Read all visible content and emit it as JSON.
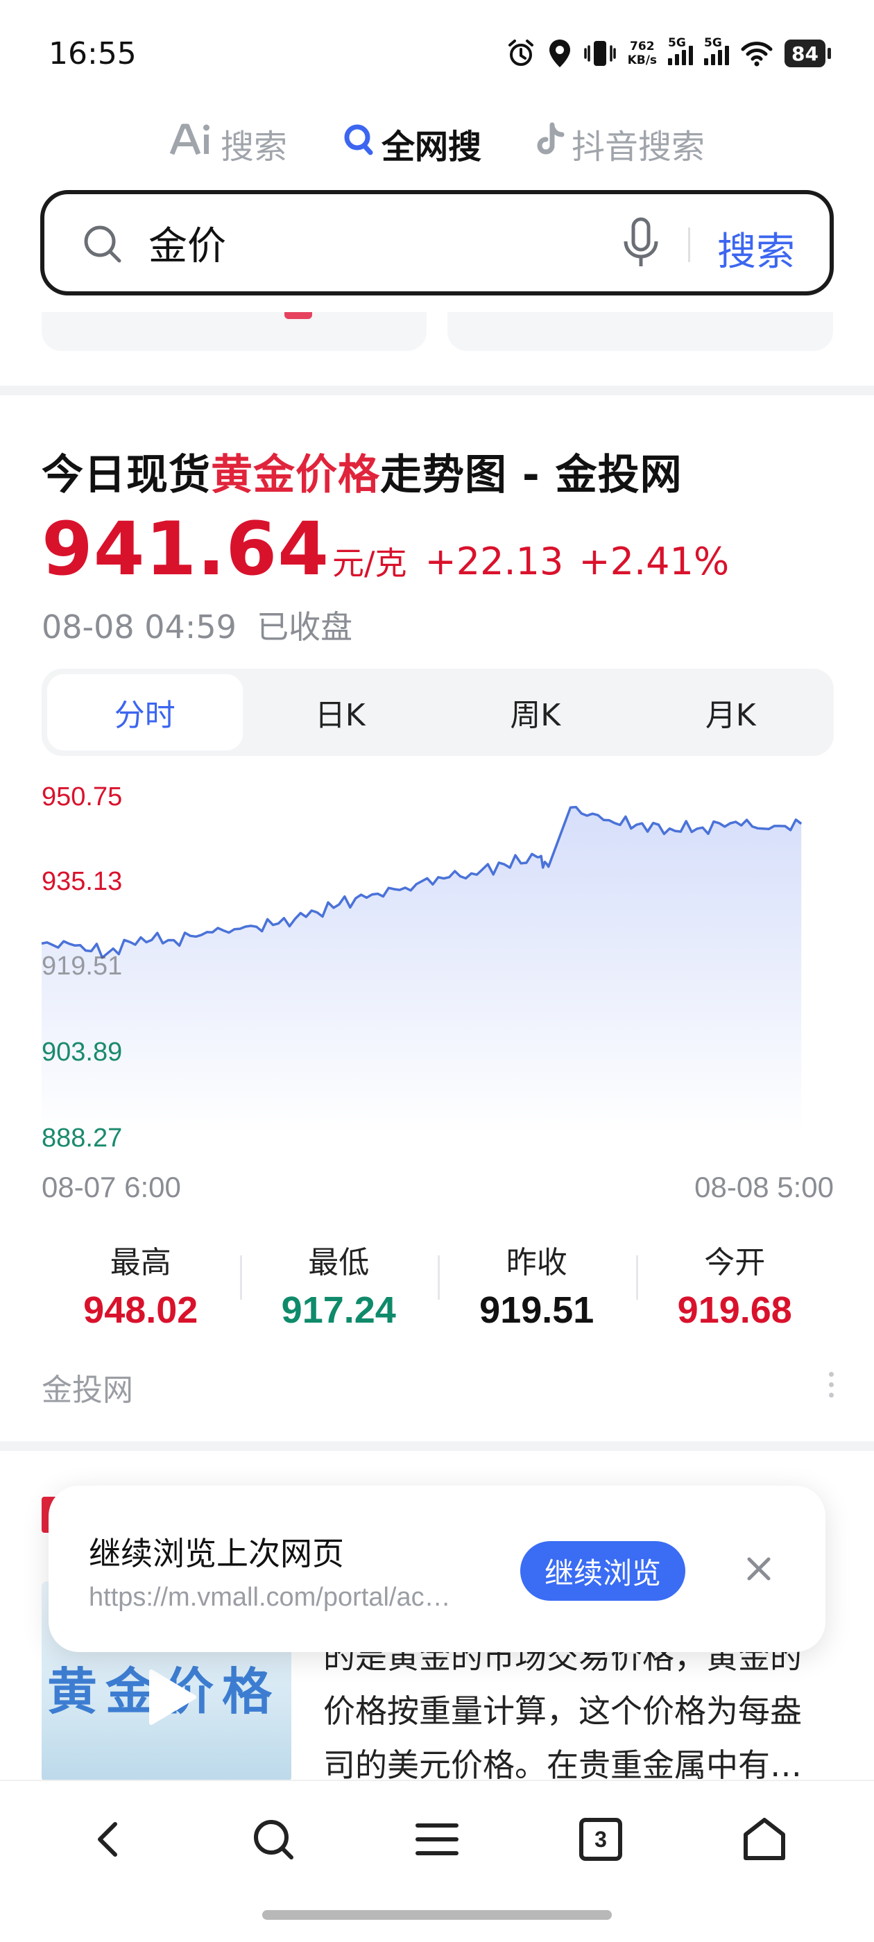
{
  "status_bar": {
    "time": "16:55",
    "net_speed_value": "762",
    "net_speed_unit": "KB/s",
    "sim1_tag": "5G",
    "sim2_tag": "5G",
    "battery": "84"
  },
  "search_tabs": [
    {
      "label": "搜索",
      "icon": "ai-icon",
      "active": false
    },
    {
      "label": "全网搜",
      "icon": "search-icon",
      "active": true
    },
    {
      "label": "抖音搜索",
      "icon": "douyin-icon",
      "active": false
    }
  ],
  "search": {
    "query": "金价",
    "button_label": "搜索"
  },
  "result": {
    "title_before": "今日现货",
    "title_highlight": "黄金价格",
    "title_after": "走势图 - 金投网",
    "price": "941.64",
    "unit": "元/克",
    "change": "+22.13",
    "change_pct": "+2.41%",
    "timestamp": "08-08 04:59",
    "market_status": "已收盘",
    "period_tabs": [
      "分时",
      "日K",
      "周K",
      "月K"
    ],
    "active_period": "分时",
    "stats": [
      {
        "label": "最高",
        "value": "948.02",
        "color": "#d9122c"
      },
      {
        "label": "最低",
        "value": "917.24",
        "color": "#0f8a6a"
      },
      {
        "label": "昨收",
        "value": "919.51",
        "color": "#111111"
      },
      {
        "label": "今开",
        "value": "919.68",
        "color": "#d9122c"
      }
    ],
    "source": "金投网"
  },
  "chart_data": {
    "type": "area",
    "title": "",
    "xlabel": "",
    "ylabel": "",
    "x_ticks": [
      "08-07 6:00",
      "08-08 5:00"
    ],
    "y_ticks": [
      "950.75",
      "935.13",
      "919.51",
      "903.89",
      "888.27"
    ],
    "ylim": [
      888.27,
      950.75
    ],
    "grid": false,
    "series": [
      {
        "x": [
          "08-07 06:00",
          "08-07 07:00",
          "08-07 08:00",
          "08-07 09:00",
          "08-07 10:00",
          "08-07 11:00",
          "08-07 12:00",
          "08-07 13:00",
          "08-07 14:00",
          "08-07 15:00",
          "08-07 16:00",
          "08-07 17:00",
          "08-07 18:00",
          "08-07 19:00",
          "08-07 20:00",
          "08-07 21:00",
          "08-07 21:20",
          "08-07 22:00",
          "08-07 23:00",
          "08-08 00:00",
          "08-08 01:00",
          "08-08 02:00",
          "08-08 03:00",
          "08-08 04:00",
          "08-08 04:59"
        ],
        "values": [
          919.3,
          918.9,
          917.3,
          920.6,
          920.0,
          921.7,
          922.4,
          923.2,
          924.9,
          927.5,
          929.6,
          931.0,
          933.2,
          934.0,
          935.9,
          937.4,
          935.4,
          947.8,
          945.2,
          944.2,
          943.4,
          943.6,
          944.8,
          943.3,
          944.4
        ]
      }
    ],
    "line_color": "#4a72d8",
    "fill_color": "#dfe6fb"
  },
  "article": {
    "thumb_text": "黄金价格",
    "lines": [
      "的是黄金的市场交易价格，黄金的",
      "价格按重量计算，这个价格为每盎",
      "司的美元价格。在贵重金属中有…"
    ]
  },
  "popup": {
    "title": "继续浏览上次网页",
    "url": "https://m.vmall.com/portal/ac…",
    "button_label": "继续浏览"
  },
  "bottom_nav": {
    "tabs_count": "3",
    "items": [
      "back-icon",
      "search-icon",
      "menu-icon",
      "tabs-icon",
      "home-icon"
    ]
  }
}
